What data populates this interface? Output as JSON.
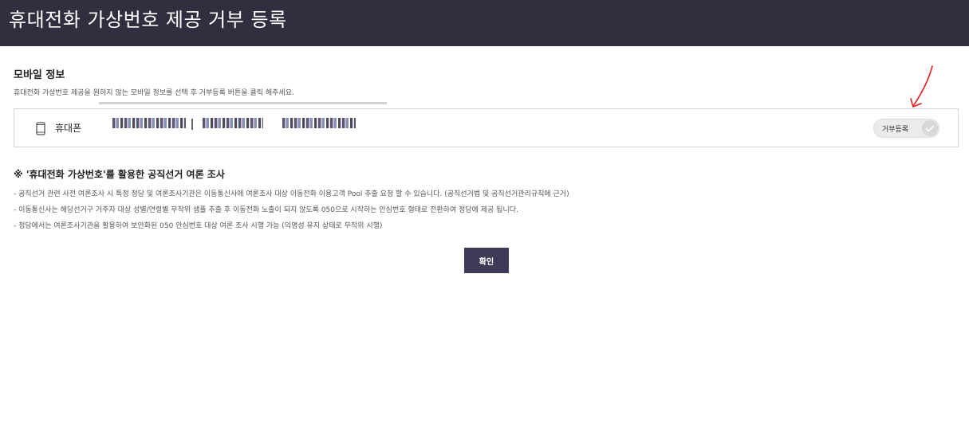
{
  "header": {
    "title": "휴대전화 가상번호 제공 거부 등록"
  },
  "mobile": {
    "section_title": "모바일 정보",
    "description": "휴대전화 가상번호 제공을 원하지 않는 모바일 정보를 선택 후 거부등록 버튼을 클릭 해주세요.",
    "device_label": "휴대폰",
    "device_icon": "phone-icon",
    "reject_button_label": "거부등록",
    "reject_icon": "check-icon"
  },
  "notice": {
    "title": "※ '휴대전화 가상번호'를 활용한 공직선거 여론 조사",
    "items": [
      "-  공직선거 관련 사전 여론조사 시 특정 정당 및 여론조사기관은 이동통신사에 여론조사 대상 이동전화 이용고객 Pool 추출 요청 할 수 있습니다. (공직선거법 및 공직선거관리규칙에 근거)",
      "-  이동통신사는 해당선거구 거주자 대상 성별/연령별 무작위 샘플 추출 후 이동전화 노출이 되지 않도록 050으로 시작하는 안심번호 형태로 전환하여 정당에 제공 됩니다.",
      "-  정당에서는 여론조사기관을 활용하여 보안화된 050 안심번호 대상 여론 조사 시행 가능 (익명성 유지 상태로 무작위 시행)"
    ]
  },
  "actions": {
    "confirm_label": "확인"
  },
  "colors": {
    "header_bg": "#302e3f",
    "button_bg": "#3f3a57",
    "annotation": "#e02020"
  }
}
